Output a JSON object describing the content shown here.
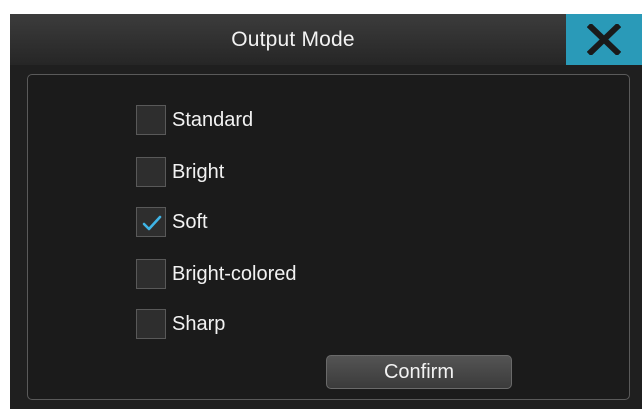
{
  "dialog": {
    "title": "Output Mode",
    "close_icon": "close-icon",
    "options": [
      {
        "label": "Standard",
        "checked": false
      },
      {
        "label": "Bright",
        "checked": false
      },
      {
        "label": "Soft",
        "checked": true
      },
      {
        "label": "Bright-colored",
        "checked": false
      },
      {
        "label": "Sharp",
        "checked": false
      }
    ],
    "confirm_label": "Confirm"
  },
  "colors": {
    "accent": "#2a9ab8",
    "check": "#3fb4e6",
    "background": "#1f1f1f",
    "text": "#f2f2f2"
  }
}
